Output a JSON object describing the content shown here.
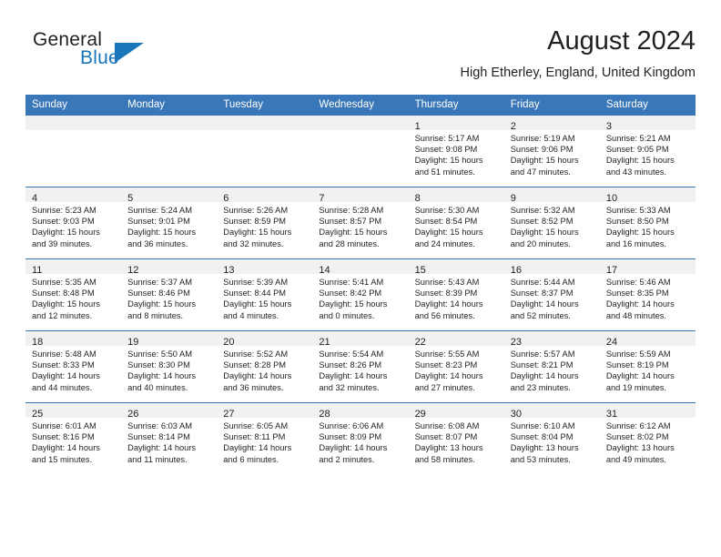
{
  "brand": {
    "name_top": "General",
    "name_bottom": "Blue",
    "triangle_color": "#1b75bb",
    "text_color": "#231f20"
  },
  "header": {
    "title": "August 2024",
    "location": "High Etherley, England, United Kingdom"
  },
  "theme": {
    "header_row_bg": "#3a77b8",
    "header_row_text": "#ffffff",
    "daynum_band_bg": "#f1f1f1",
    "grid_line": "#3a77b8",
    "body_text": "#231f20"
  },
  "weekday_headers": [
    "Sunday",
    "Monday",
    "Tuesday",
    "Wednesday",
    "Thursday",
    "Friday",
    "Saturday"
  ],
  "labels": {
    "sunrise_prefix": "Sunrise:",
    "sunset_prefix": "Sunset:",
    "daylight_prefix": "Daylight:"
  },
  "weeks": [
    [
      {
        "day": "",
        "lines": [
          "",
          "",
          "",
          ""
        ]
      },
      {
        "day": "",
        "lines": [
          "",
          "",
          "",
          ""
        ]
      },
      {
        "day": "",
        "lines": [
          "",
          "",
          "",
          ""
        ]
      },
      {
        "day": "",
        "lines": [
          "",
          "",
          "",
          ""
        ]
      },
      {
        "day": "1",
        "lines": [
          "Sunrise: 5:17 AM",
          "Sunset: 9:08 PM",
          "Daylight: 15 hours",
          "and 51 minutes."
        ]
      },
      {
        "day": "2",
        "lines": [
          "Sunrise: 5:19 AM",
          "Sunset: 9:06 PM",
          "Daylight: 15 hours",
          "and 47 minutes."
        ]
      },
      {
        "day": "3",
        "lines": [
          "Sunrise: 5:21 AM",
          "Sunset: 9:05 PM",
          "Daylight: 15 hours",
          "and 43 minutes."
        ]
      }
    ],
    [
      {
        "day": "4",
        "lines": [
          "Sunrise: 5:23 AM",
          "Sunset: 9:03 PM",
          "Daylight: 15 hours",
          "and 39 minutes."
        ]
      },
      {
        "day": "5",
        "lines": [
          "Sunrise: 5:24 AM",
          "Sunset: 9:01 PM",
          "Daylight: 15 hours",
          "and 36 minutes."
        ]
      },
      {
        "day": "6",
        "lines": [
          "Sunrise: 5:26 AM",
          "Sunset: 8:59 PM",
          "Daylight: 15 hours",
          "and 32 minutes."
        ]
      },
      {
        "day": "7",
        "lines": [
          "Sunrise: 5:28 AM",
          "Sunset: 8:57 PM",
          "Daylight: 15 hours",
          "and 28 minutes."
        ]
      },
      {
        "day": "8",
        "lines": [
          "Sunrise: 5:30 AM",
          "Sunset: 8:54 PM",
          "Daylight: 15 hours",
          "and 24 minutes."
        ]
      },
      {
        "day": "9",
        "lines": [
          "Sunrise: 5:32 AM",
          "Sunset: 8:52 PM",
          "Daylight: 15 hours",
          "and 20 minutes."
        ]
      },
      {
        "day": "10",
        "lines": [
          "Sunrise: 5:33 AM",
          "Sunset: 8:50 PM",
          "Daylight: 15 hours",
          "and 16 minutes."
        ]
      }
    ],
    [
      {
        "day": "11",
        "lines": [
          "Sunrise: 5:35 AM",
          "Sunset: 8:48 PM",
          "Daylight: 15 hours",
          "and 12 minutes."
        ]
      },
      {
        "day": "12",
        "lines": [
          "Sunrise: 5:37 AM",
          "Sunset: 8:46 PM",
          "Daylight: 15 hours",
          "and 8 minutes."
        ]
      },
      {
        "day": "13",
        "lines": [
          "Sunrise: 5:39 AM",
          "Sunset: 8:44 PM",
          "Daylight: 15 hours",
          "and 4 minutes."
        ]
      },
      {
        "day": "14",
        "lines": [
          "Sunrise: 5:41 AM",
          "Sunset: 8:42 PM",
          "Daylight: 15 hours",
          "and 0 minutes."
        ]
      },
      {
        "day": "15",
        "lines": [
          "Sunrise: 5:43 AM",
          "Sunset: 8:39 PM",
          "Daylight: 14 hours",
          "and 56 minutes."
        ]
      },
      {
        "day": "16",
        "lines": [
          "Sunrise: 5:44 AM",
          "Sunset: 8:37 PM",
          "Daylight: 14 hours",
          "and 52 minutes."
        ]
      },
      {
        "day": "17",
        "lines": [
          "Sunrise: 5:46 AM",
          "Sunset: 8:35 PM",
          "Daylight: 14 hours",
          "and 48 minutes."
        ]
      }
    ],
    [
      {
        "day": "18",
        "lines": [
          "Sunrise: 5:48 AM",
          "Sunset: 8:33 PM",
          "Daylight: 14 hours",
          "and 44 minutes."
        ]
      },
      {
        "day": "19",
        "lines": [
          "Sunrise: 5:50 AM",
          "Sunset: 8:30 PM",
          "Daylight: 14 hours",
          "and 40 minutes."
        ]
      },
      {
        "day": "20",
        "lines": [
          "Sunrise: 5:52 AM",
          "Sunset: 8:28 PM",
          "Daylight: 14 hours",
          "and 36 minutes."
        ]
      },
      {
        "day": "21",
        "lines": [
          "Sunrise: 5:54 AM",
          "Sunset: 8:26 PM",
          "Daylight: 14 hours",
          "and 32 minutes."
        ]
      },
      {
        "day": "22",
        "lines": [
          "Sunrise: 5:55 AM",
          "Sunset: 8:23 PM",
          "Daylight: 14 hours",
          "and 27 minutes."
        ]
      },
      {
        "day": "23",
        "lines": [
          "Sunrise: 5:57 AM",
          "Sunset: 8:21 PM",
          "Daylight: 14 hours",
          "and 23 minutes."
        ]
      },
      {
        "day": "24",
        "lines": [
          "Sunrise: 5:59 AM",
          "Sunset: 8:19 PM",
          "Daylight: 14 hours",
          "and 19 minutes."
        ]
      }
    ],
    [
      {
        "day": "25",
        "lines": [
          "Sunrise: 6:01 AM",
          "Sunset: 8:16 PM",
          "Daylight: 14 hours",
          "and 15 minutes."
        ]
      },
      {
        "day": "26",
        "lines": [
          "Sunrise: 6:03 AM",
          "Sunset: 8:14 PM",
          "Daylight: 14 hours",
          "and 11 minutes."
        ]
      },
      {
        "day": "27",
        "lines": [
          "Sunrise: 6:05 AM",
          "Sunset: 8:11 PM",
          "Daylight: 14 hours",
          "and 6 minutes."
        ]
      },
      {
        "day": "28",
        "lines": [
          "Sunrise: 6:06 AM",
          "Sunset: 8:09 PM",
          "Daylight: 14 hours",
          "and 2 minutes."
        ]
      },
      {
        "day": "29",
        "lines": [
          "Sunrise: 6:08 AM",
          "Sunset: 8:07 PM",
          "Daylight: 13 hours",
          "and 58 minutes."
        ]
      },
      {
        "day": "30",
        "lines": [
          "Sunrise: 6:10 AM",
          "Sunset: 8:04 PM",
          "Daylight: 13 hours",
          "and 53 minutes."
        ]
      },
      {
        "day": "31",
        "lines": [
          "Sunrise: 6:12 AM",
          "Sunset: 8:02 PM",
          "Daylight: 13 hours",
          "and 49 minutes."
        ]
      }
    ]
  ]
}
